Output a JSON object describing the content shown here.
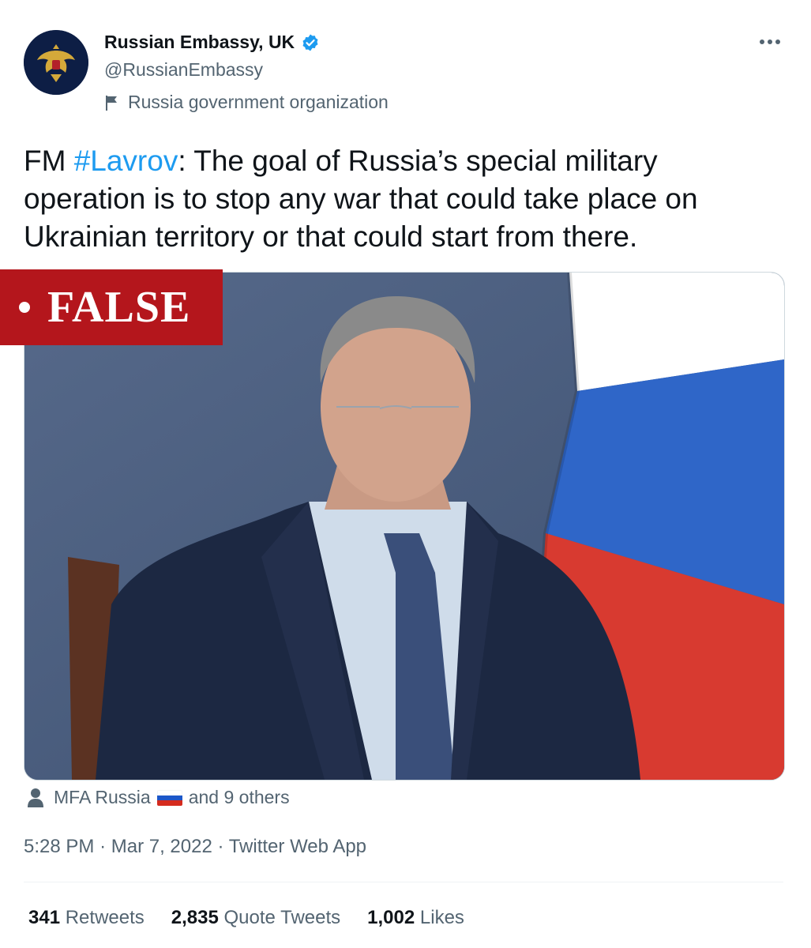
{
  "author": {
    "display_name": "Russian Embassy, UK",
    "handle": "@RussianEmbassy",
    "label": "Russia government organization",
    "avatar_icon": "double-headed-eagle-emblem",
    "verified_icon": "verified-badge-icon"
  },
  "tweet": {
    "text_prefix": "FM ",
    "hashtag": "#Lavrov",
    "text_suffix": ": The goal of Russia’s special military operation is to stop any war that could take place on Ukrainian territory or that could start from there."
  },
  "overlay": {
    "badge_text": "FALSE",
    "badge_color": "#b4161c"
  },
  "tagged": {
    "first": "MFA Russia",
    "rest": "and 9 others"
  },
  "meta": {
    "time": "5:28 PM",
    "date": "Mar 7, 2022",
    "source": "Twitter Web App"
  },
  "stats": {
    "retweets_count": "341",
    "retweets_label": "Retweets",
    "quotes_count": "2,835",
    "quotes_label": "Quote Tweets",
    "likes_count": "1,002",
    "likes_label": "Likes"
  },
  "colors": {
    "link": "#1d9bf0",
    "secondary_text": "#536471",
    "primary_text": "#0f1419"
  }
}
